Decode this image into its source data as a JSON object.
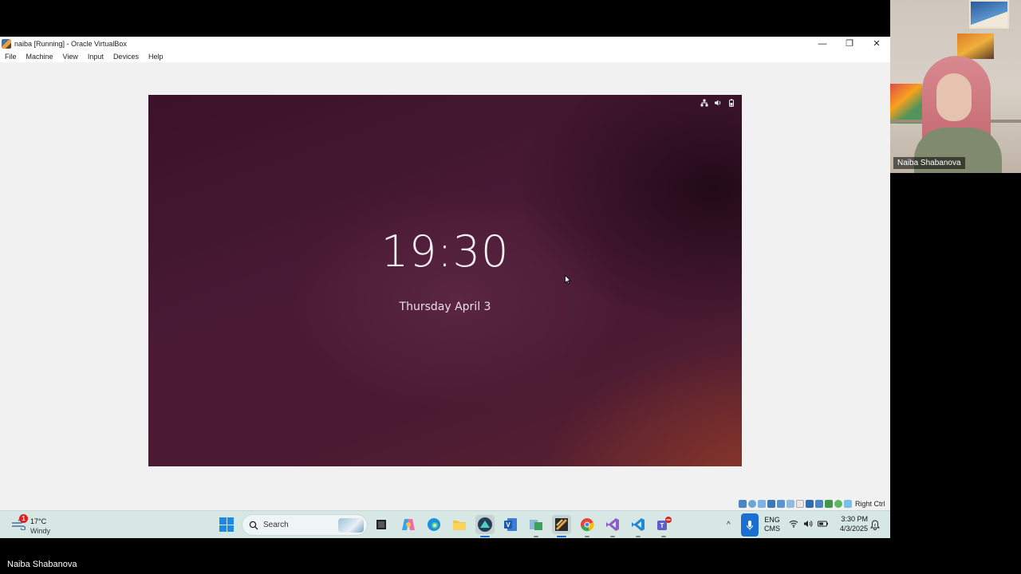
{
  "window": {
    "title": "naiba [Running] - Oracle VirtualBox",
    "minimize_icon": "—",
    "restore_icon": "❐",
    "close_icon": "✕"
  },
  "menu": {
    "items": [
      "File",
      "Machine",
      "View",
      "Input",
      "Devices",
      "Help"
    ]
  },
  "guest": {
    "time": "19:30",
    "date": "Thursday April 3",
    "status_icons": [
      "network-icon",
      "volume-icon",
      "battery-icon"
    ]
  },
  "vbox_status": {
    "host_key": "Right Ctrl"
  },
  "taskbar": {
    "weather": {
      "alert_count": "1",
      "temp": "17°C",
      "desc": "Windy"
    },
    "search_label": "Search",
    "apps": [
      "task-view",
      "copilot",
      "edge",
      "file-explorer",
      "app-active",
      "visio",
      "tool",
      "virtualbox",
      "chrome",
      "visual-studio",
      "vscode",
      "teams"
    ],
    "lang_primary": "ENG",
    "lang_secondary": "CMS",
    "time": "3:30 PM",
    "date": "4/3/2025",
    "chevron": "^"
  },
  "webcam": {
    "name": "Naiba Shabanova"
  },
  "presenter": {
    "name": "Naiba Shabanova"
  },
  "colors": {
    "accent": "#1a6fd1",
    "taskbar": "#d6e7e4",
    "guest_bg": "#4a1a35"
  }
}
